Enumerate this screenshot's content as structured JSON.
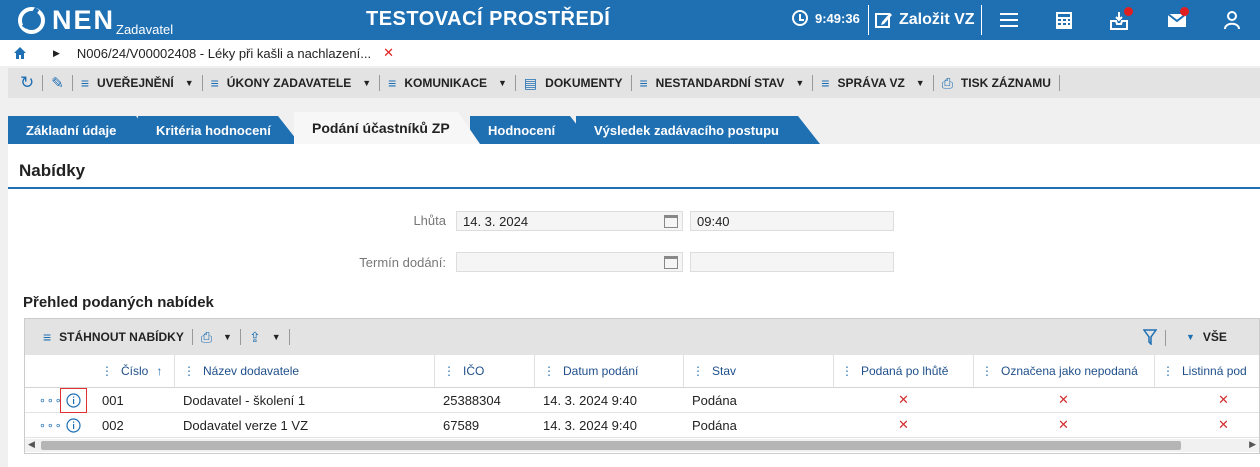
{
  "header": {
    "logo": "NEN",
    "logo_sub": "Zadavatel",
    "env_title": "TESTOVACÍ PROSTŘEDÍ",
    "time": "9:49:36",
    "create_label": "Založit VZ"
  },
  "breadcrumb": {
    "record": "N006/24/V00002408 - Léky při kašli a nachlazení..."
  },
  "toolbar": {
    "publish": "UVEŘEJNĚNÍ",
    "actions": "ÚKONY ZADAVATELE",
    "communication": "KOMUNIKACE",
    "documents": "DOKUMENTY",
    "nonstandard": "NESTANDARDNÍ STAV",
    "management": "SPRÁVA VZ",
    "print": "TISK ZÁZNAMU"
  },
  "tabs": [
    "Základní údaje",
    "Kritéria hodnocení",
    "Podání účastníků ZP",
    "Hodnocení",
    "Výsledek zadávacího postupu"
  ],
  "section": {
    "title": "Nabídky",
    "deadline_label": "Lhůta",
    "deadline_date": "14. 3. 2024",
    "deadline_time": "09:40",
    "delivery_label": "Termín dodání:",
    "delivery_date": "",
    "delivery_time": ""
  },
  "overview": {
    "title": "Přehled podaných nabídek",
    "download_label": "STÁHNOUT NABÍDKY",
    "all_label": "VŠE",
    "columns": [
      "Číslo",
      "Název dodavatele",
      "IČO",
      "Datum podání",
      "Stav",
      "Podaná po lhůtě",
      "Označena jako nepodaná",
      "Listinná pod"
    ],
    "rows": [
      {
        "number": "001",
        "supplier": "Dodavatel - školení 1",
        "ico": "25388304",
        "date": "14. 3. 2024 9:40",
        "status": "Podána",
        "late": "✕",
        "unsubmitted": "✕",
        "paper": "✕"
      },
      {
        "number": "002",
        "supplier": "Dodavatel verze 1 VZ",
        "ico": "67589",
        "date": "14. 3. 2024 9:40",
        "status": "Podána",
        "late": "✕",
        "unsubmitted": "✕",
        "paper": "✕"
      }
    ]
  },
  "colors": {
    "brand": "#1f6fb3",
    "red": "#d32f2f"
  }
}
